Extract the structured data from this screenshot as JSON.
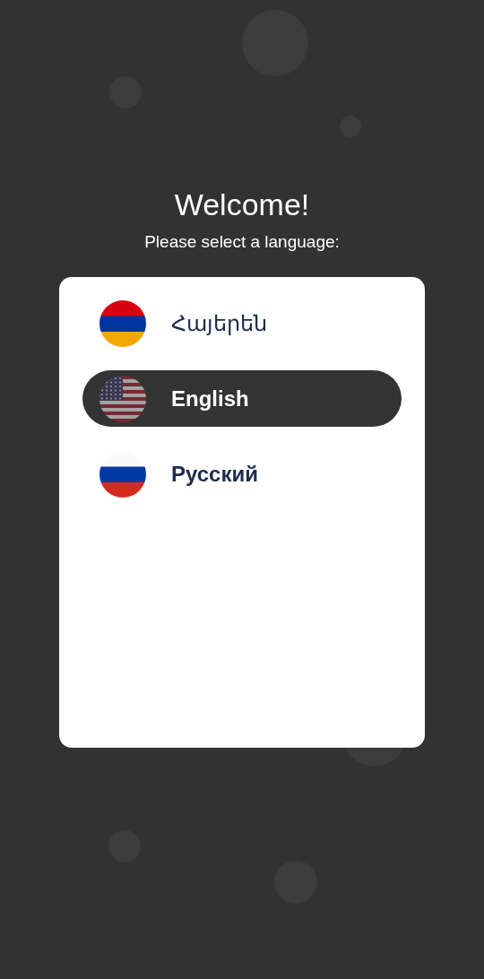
{
  "title": "Welcome!",
  "subtitle": "Please select a language:",
  "languages": [
    {
      "label": "Հայերեն",
      "kind": "am",
      "selected": false
    },
    {
      "label": "English",
      "kind": "us",
      "selected": true
    },
    {
      "label": "Русский",
      "kind": "ru",
      "selected": false
    }
  ]
}
